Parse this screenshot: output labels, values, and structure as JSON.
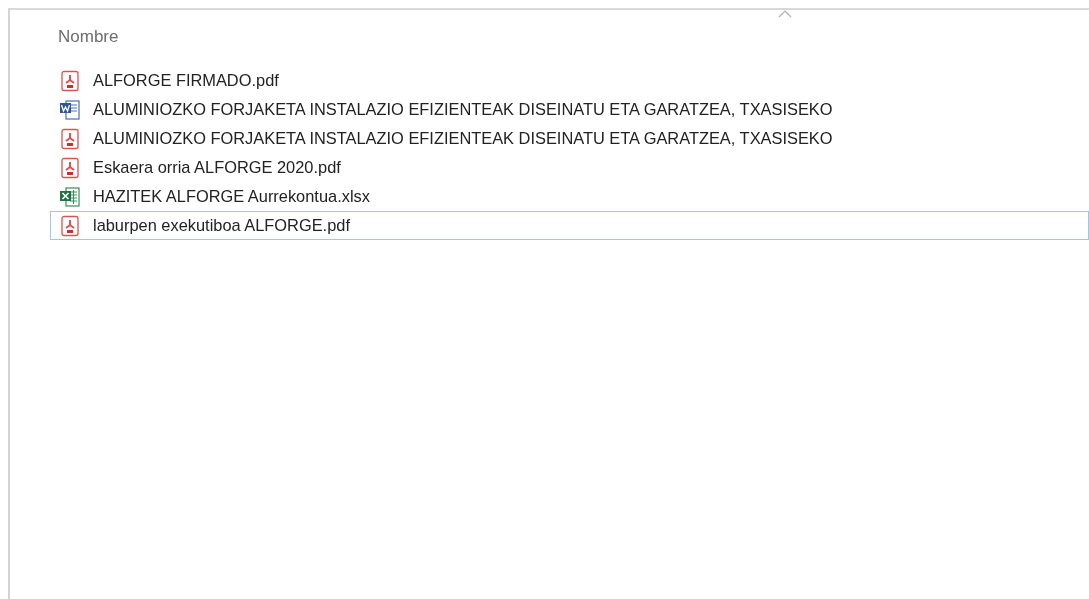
{
  "header": {
    "column": "Nombre",
    "sorted_ascending": true
  },
  "files": [
    {
      "name": "ALFORGE FIRMADO.pdf",
      "kind": "pdf",
      "selected": false
    },
    {
      "name": "ALUMINIOZKO FORJAKETA INSTALAZIO EFIZIENTEAK DISEINATU ETA GARATZEA, TXASISEKO",
      "kind": "word",
      "selected": false
    },
    {
      "name": "ALUMINIOZKO FORJAKETA INSTALAZIO EFIZIENTEAK DISEINATU ETA GARATZEA, TXASISEKO",
      "kind": "pdf",
      "selected": false
    },
    {
      "name": "Eskaera orria ALFORGE 2020.pdf",
      "kind": "pdf",
      "selected": false
    },
    {
      "name": "HAZITEK ALFORGE Aurrekontua.xlsx",
      "kind": "excel",
      "selected": false
    },
    {
      "name": "laburpen exekutiboa ALFORGE.pdf",
      "kind": "pdf",
      "selected": true
    }
  ]
}
